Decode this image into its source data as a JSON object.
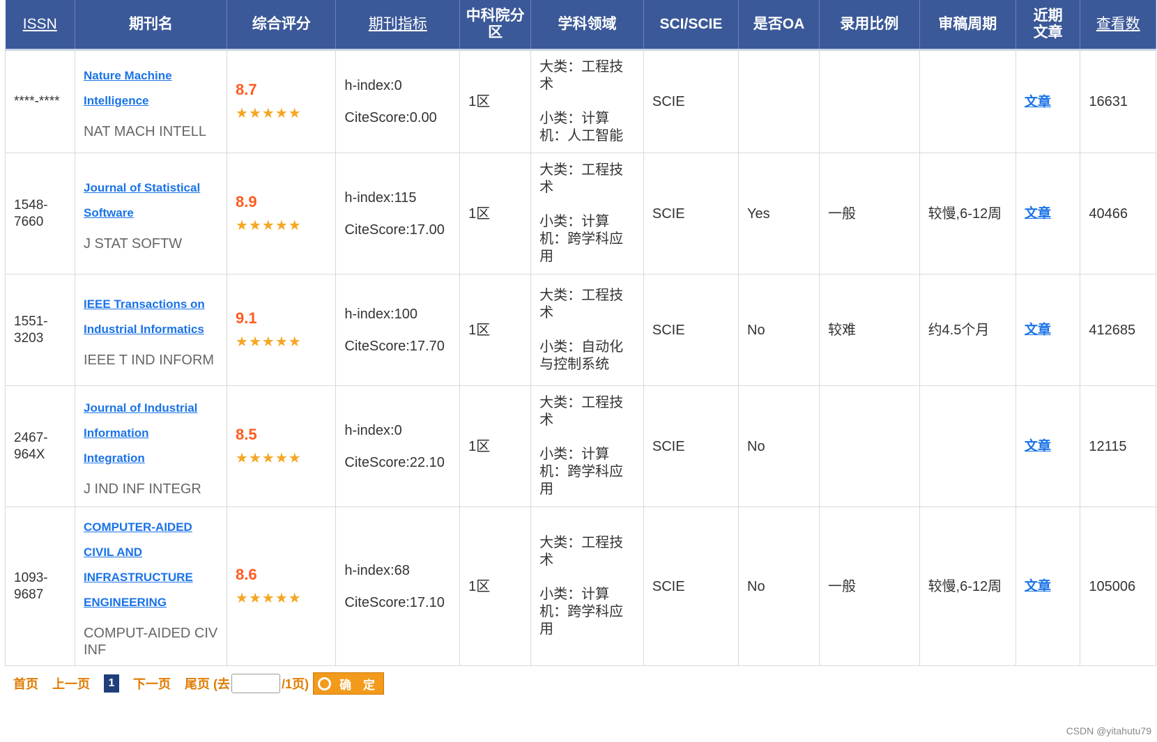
{
  "headers": {
    "issn": "ISSN",
    "name": "期刊名",
    "score": "综合评分",
    "metrics": "期刊指标",
    "cas_a": "中科院分",
    "cas_b": "区",
    "subject": "学科领域",
    "sci": "SCI/SCIE",
    "oa": "是否OA",
    "acceptance": "录用比例",
    "review": "审稿周期",
    "recent_a": "近期",
    "recent_b": "文章",
    "views": "查看数"
  },
  "rows": [
    {
      "issn_a": "****-****",
      "issn_b": "",
      "name_lines": [
        "Nature Machine",
        "Intelligence"
      ],
      "abbr": "NAT MACH INTELL",
      "score": "8.7",
      "stars": "★★★★★",
      "hindex": "h-index:0",
      "citescore": "CiteScore:0.00",
      "cas": "1区",
      "major": "大类：工程技术",
      "minor": "小类：计算机：人工智能",
      "sci": "SCIE",
      "oa": "",
      "acceptance": "",
      "review": "",
      "article": "文章",
      "views": "16631"
    },
    {
      "issn_a": "1548-",
      "issn_b": "7660",
      "name_lines": [
        "Journal of Statistical",
        "Software"
      ],
      "abbr": "J STAT SOFTW",
      "score": "8.9",
      "stars": "★★★★★",
      "hindex": "h-index:115",
      "citescore": "CiteScore:17.00",
      "cas": "1区",
      "major": "大类：工程技术",
      "minor": "小类：计算机：跨学科应用",
      "sci": "SCIE",
      "oa": "Yes",
      "acceptance": "一般",
      "review": "较慢,6-12周",
      "article": "文章",
      "views": "40466"
    },
    {
      "issn_a": "1551-",
      "issn_b": "3203",
      "name_lines": [
        "IEEE Transactions on",
        "Industrial Informatics"
      ],
      "abbr": "IEEE T IND INFORM",
      "score": "9.1",
      "stars": "★★★★★",
      "hindex": "h-index:100",
      "citescore": "CiteScore:17.70",
      "cas": "1区",
      "major": "大类：工程技术",
      "minor": "小类：自动化与控制系统",
      "sci": "SCIE",
      "oa": "No",
      "acceptance": "较难",
      "review": "约4.5个月",
      "article": "文章",
      "views": "412685"
    },
    {
      "issn_a": "2467-",
      "issn_b": "964X",
      "name_lines": [
        "Journal of Industrial",
        "Information",
        "Integration"
      ],
      "abbr": "J IND INF INTEGR",
      "score": "8.5",
      "stars": "★★★★★",
      "hindex": "h-index:0",
      "citescore": "CiteScore:22.10",
      "cas": "1区",
      "major": "大类：工程技术",
      "minor": "小类：计算机：跨学科应用",
      "sci": "SCIE",
      "oa": "No",
      "acceptance": "",
      "review": "",
      "article": "文章",
      "views": "12115"
    },
    {
      "issn_a": "1093-",
      "issn_b": "9687",
      "name_lines": [
        "COMPUTER-AIDED",
        "CIVIL AND",
        "INFRASTRUCTURE",
        "ENGINEERING"
      ],
      "abbr": "COMPUT-AIDED CIV INF",
      "score": "8.6",
      "stars": "★★★★★",
      "hindex": "h-index:68",
      "citescore": "CiteScore:17.10",
      "cas": "1区",
      "major": "大类：工程技术",
      "minor": "小类：计算机：跨学科应用",
      "sci": "SCIE",
      "oa": "No",
      "acceptance": "一般",
      "review": "较慢,6-12周",
      "article": "文章",
      "views": "105006"
    }
  ],
  "pager": {
    "first": "首页",
    "prev": "上一页",
    "current": "1",
    "next": "下一页",
    "last_prefix": "尾页 (去",
    "last_suffix": "/1页)",
    "input_value": "",
    "confirm": "确 定"
  },
  "watermark": "CSDN @yitahutu79",
  "colors": {
    "header_bg": "#3b5998",
    "link": "#1a73e8",
    "score": "#ff5a1f",
    "star": "#f5a623",
    "pager": "#e07b00",
    "button": "#f29a1c"
  }
}
